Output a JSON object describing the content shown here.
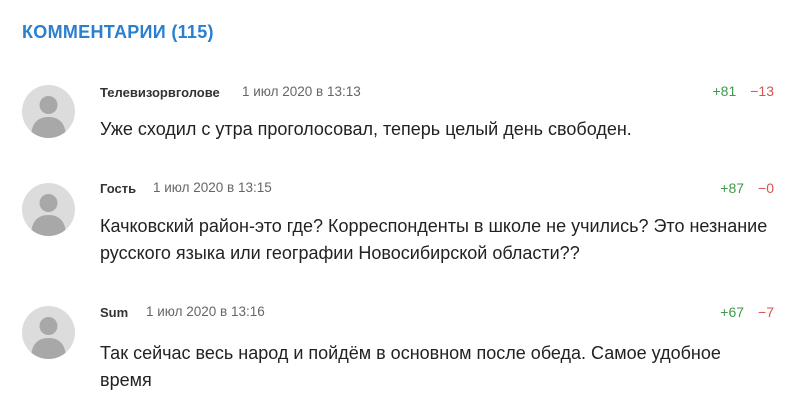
{
  "header": {
    "title": "КОММЕНТАРИИ (115)"
  },
  "comments": [
    {
      "author": "Телевизорвголове",
      "time": "1 июл 2020 в 13:13",
      "upvotes": "+81",
      "downvotes": "−13",
      "text": "Уже сходил с утра проголосовал, теперь целый день свободен."
    },
    {
      "author": "Гость",
      "time": "1 июл 2020 в 13:15",
      "upvotes": "+87",
      "downvotes": "−0",
      "text": "Качковский район-это где? Корреспонденты в школе не учились? Это незнание русского языка или географии Новосибирской области??"
    },
    {
      "author": "Sum",
      "time": "1 июл 2020 в 13:16",
      "upvotes": "+67",
      "downvotes": "−7",
      "text": "Так сейчас весь народ и пойдём в основном после обеда. Самое удобное время"
    }
  ],
  "colors": {
    "heading": "#2a7fcf",
    "upvote": "#3c9a4a",
    "downvote": "#d9534f",
    "avatar_bg": "#dcdcdc",
    "avatar_figure": "#a8a8a8"
  },
  "icons": {
    "avatar": "user-silhouette-icon"
  }
}
